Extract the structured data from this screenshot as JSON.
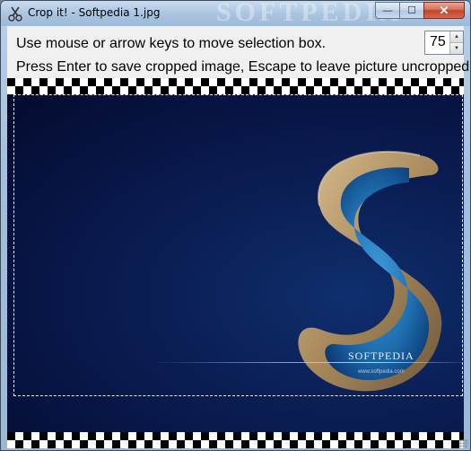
{
  "window": {
    "title": "Crop it! - Softpedia 1.jpg",
    "title_watermark": "SOFTPEDIA",
    "minimize_glyph": "—",
    "maximize_glyph": "☐",
    "close_glyph": "✕"
  },
  "instructions": {
    "line1": "Use mouse or arrow keys to move selection box.",
    "line2": "Press Enter to save cropped image, Escape to leave picture uncropped."
  },
  "quality_spinner": {
    "value": "75"
  },
  "image": {
    "logo_text": "SOFTPEDIA",
    "logo_url": "www.softpedia.com"
  },
  "colors": {
    "background_blue": "#071443",
    "island_sand": "#b89b6e",
    "lagoon_blue": "#1f6fb0",
    "close_button_red": "#c2442a"
  },
  "icons": {
    "app": "scissors-icon",
    "spin_up": "arrow-up-icon",
    "spin_down": "arrow-down-icon"
  }
}
